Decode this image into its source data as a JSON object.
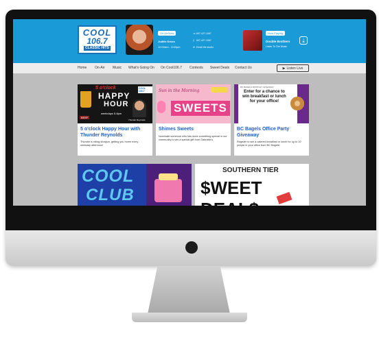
{
  "brand": {
    "line1": "COOL",
    "line2": "106.7",
    "line3": "CLASSIC HITS"
  },
  "header": {
    "onair_label": "On Air Now",
    "host_name": "Judith Gross",
    "host_time": "10:00am - 3:00pm",
    "contacts": [
      "607-427-1067",
      "607-427-1067",
      "Email the studio"
    ],
    "now_playing_label": "Now Playing",
    "song_title": "Double Brothers",
    "song_sub": "Listen To The Music",
    "download_icon": "download-icon"
  },
  "nav": {
    "items": [
      "Home",
      "On-Air",
      "Music",
      "What's Going On",
      "On Cool106.7",
      "Contests",
      "Sweet Deals",
      "Contact Us"
    ],
    "listen_label": "Listen Live"
  },
  "cards": [
    {
      "title": "5 o'clock Happy Hour with Thunder Reynolds",
      "body": "Thunder is riding shotgun, getting you home every weekday afternoon!",
      "img_line1": "5 o'clock",
      "img_line2": "HAPPY",
      "img_line3": "HOUR",
      "img_line4": "weekdays 5-6pm",
      "img_sponsor": "BEEF",
      "img_host": "Thunder Reynolds",
      "img_logo": "COOL 106.7"
    },
    {
      "title": "Shimes Sweets",
      "body": "Nominate someone who has done something special in our community to win a special gift from Gabriella's",
      "img_script": "Sun in the Morning",
      "img_word": "SWEETS"
    },
    {
      "title": "BC Bagels Office Party Giveaway",
      "body": "Register to win a catered breakfast or lunch for up to 10 people in your office from BC Bagels!",
      "img_small": "BC BAGELS MONTHLY GIVEAWAY",
      "img_text": "Enter for a chance to win breakfast or lunch for your office!"
    }
  ],
  "banners": [
    {
      "line1": "COOL",
      "line2": "CLUB"
    },
    {
      "line1": "SOUTHERN TIER",
      "line2": "$WEET DEAL$"
    }
  ],
  "colors": {
    "brand_blue": "#1a9ad6",
    "link_blue": "#1e5fc8",
    "nav_bg": "#ececec"
  }
}
